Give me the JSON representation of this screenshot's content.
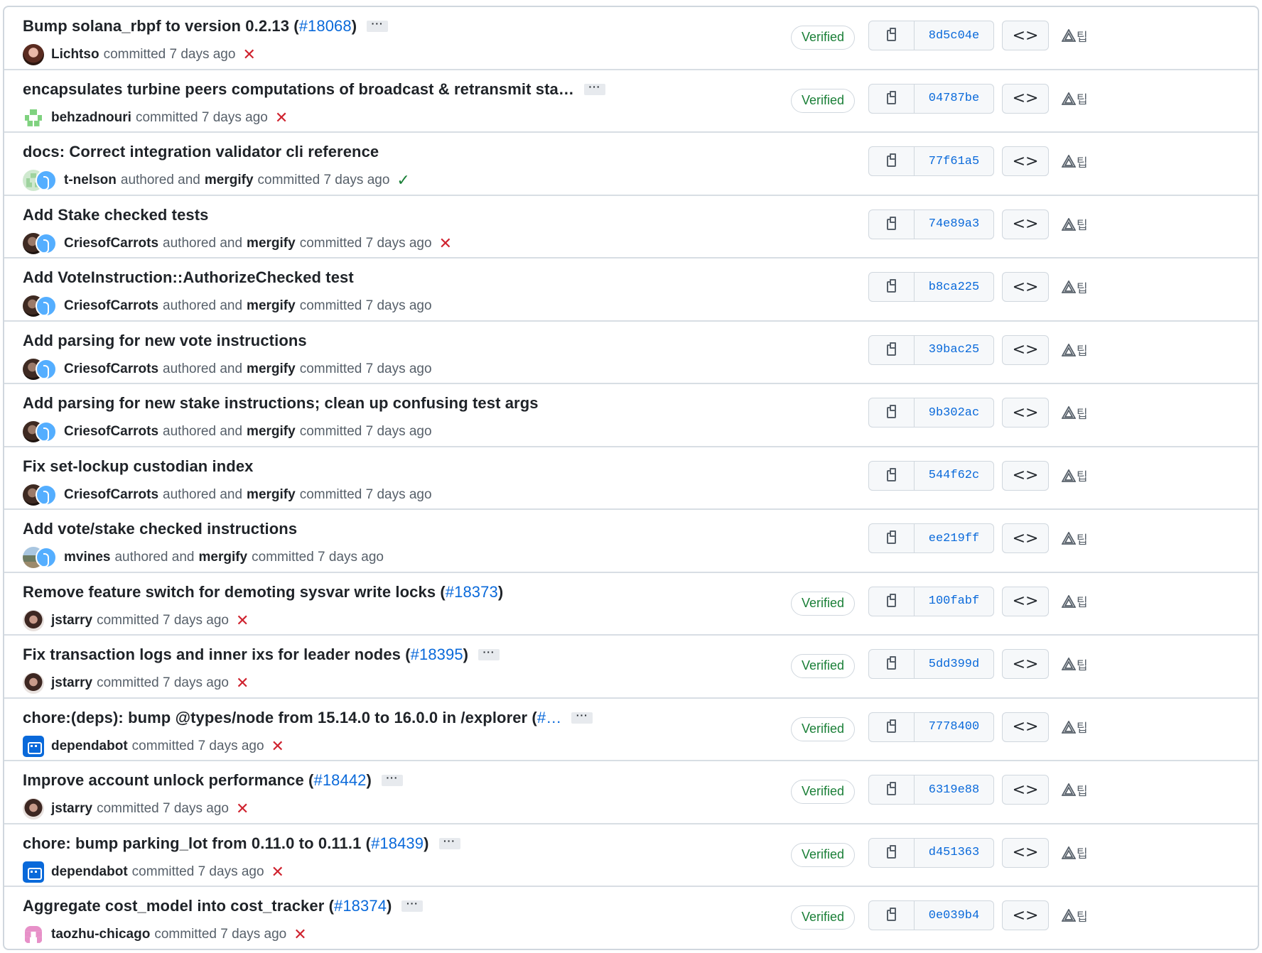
{
  "commits": [
    {
      "message": "Bump solana_rbpf to version 0.2.13 (",
      "pr": "#18068",
      "close": ")",
      "has_ellipsis": true,
      "avatars": [
        "av-dark"
      ],
      "author": "Lichtso",
      "author_text": "",
      "committer": "",
      "committed_text": "committed 7 days ago",
      "status": "fail",
      "verified": "Verified",
      "sha": "8d5c04e"
    },
    {
      "message": "encapsulates turbine peers computations of broadcast & retransmit sta…",
      "pr": "",
      "close": "",
      "has_ellipsis": true,
      "avatars": [
        "av-pix"
      ],
      "author": "behzadnouri",
      "author_text": "",
      "committer": "",
      "committed_text": "committed 7 days ago",
      "status": "fail",
      "verified": "Verified",
      "sha": "04787be"
    },
    {
      "message": "docs: Correct integration validator cli reference",
      "pr": "",
      "close": "",
      "has_ellipsis": false,
      "avatars": [
        "av-tn",
        "av-merge"
      ],
      "author": "t-nelson",
      "author_text": "authored and",
      "committer": "mergify",
      "committed_text": "committed 7 days ago",
      "status": "ok",
      "verified": "",
      "sha": "77f61a5"
    },
    {
      "message": "Add Stake checked tests",
      "pr": "",
      "close": "",
      "has_ellipsis": false,
      "avatars": [
        "av-cries",
        "av-merge"
      ],
      "author": "CriesofCarrots",
      "author_text": "authored and",
      "committer": "mergify",
      "committed_text": "committed 7 days ago",
      "status": "fail",
      "verified": "",
      "sha": "74e89a3"
    },
    {
      "message": "Add VoteInstruction::AuthorizeChecked test",
      "pr": "",
      "close": "",
      "has_ellipsis": false,
      "avatars": [
        "av-cries",
        "av-merge"
      ],
      "author": "CriesofCarrots",
      "author_text": "authored and",
      "committer": "mergify",
      "committed_text": "committed 7 days ago",
      "status": "",
      "verified": "",
      "sha": "b8ca225"
    },
    {
      "message": "Add parsing for new vote instructions",
      "pr": "",
      "close": "",
      "has_ellipsis": false,
      "avatars": [
        "av-cries",
        "av-merge"
      ],
      "author": "CriesofCarrots",
      "author_text": "authored and",
      "committer": "mergify",
      "committed_text": "committed 7 days ago",
      "status": "",
      "verified": "",
      "sha": "39bac25"
    },
    {
      "message": "Add parsing for new stake instructions; clean up confusing test args",
      "pr": "",
      "close": "",
      "has_ellipsis": false,
      "avatars": [
        "av-cries",
        "av-merge"
      ],
      "author": "CriesofCarrots",
      "author_text": "authored and",
      "committer": "mergify",
      "committed_text": "committed 7 days ago",
      "status": "",
      "verified": "",
      "sha": "9b302ac"
    },
    {
      "message": "Fix set-lockup custodian index",
      "pr": "",
      "close": "",
      "has_ellipsis": false,
      "avatars": [
        "av-cries",
        "av-merge"
      ],
      "author": "CriesofCarrots",
      "author_text": "authored and",
      "committer": "mergify",
      "committed_text": "committed 7 days ago",
      "status": "",
      "verified": "",
      "sha": "544f62c"
    },
    {
      "message": "Add vote/stake checked instructions",
      "pr": "",
      "close": "",
      "has_ellipsis": false,
      "avatars": [
        "av-mv",
        "av-merge"
      ],
      "author": "mvines",
      "author_text": "authored and",
      "committer": "mergify",
      "committed_text": "committed 7 days ago",
      "status": "",
      "verified": "",
      "sha": "ee219ff"
    },
    {
      "message": "Remove feature switch for demoting sysvar write locks (",
      "pr": "#18373",
      "close": ")",
      "has_ellipsis": false,
      "avatars": [
        "av-js"
      ],
      "author": "jstarry",
      "author_text": "",
      "committer": "",
      "committed_text": "committed 7 days ago",
      "status": "fail",
      "verified": "Verified",
      "sha": "100fabf"
    },
    {
      "message": "Fix transaction logs and inner ixs for leader nodes (",
      "pr": "#18395",
      "close": ")",
      "has_ellipsis": true,
      "avatars": [
        "av-js"
      ],
      "author": "jstarry",
      "author_text": "",
      "committer": "",
      "committed_text": "committed 7 days ago",
      "status": "fail",
      "verified": "Verified",
      "sha": "5dd399d"
    },
    {
      "message": "chore:(deps): bump @types/node from 15.14.0 to 16.0.0 in /explorer (",
      "pr": "#…",
      "close": "",
      "has_ellipsis": true,
      "avatars": [
        "av-bot"
      ],
      "author": "dependabot",
      "author_text": "",
      "committer": "",
      "committed_text": "committed 7 days ago",
      "status": "fail",
      "verified": "Verified",
      "sha": "7778400"
    },
    {
      "message": "Improve account unlock performance (",
      "pr": "#18442",
      "close": ")",
      "has_ellipsis": true,
      "avatars": [
        "av-js"
      ],
      "author": "jstarry",
      "author_text": "",
      "committer": "",
      "committed_text": "committed 7 days ago",
      "status": "fail",
      "verified": "Verified",
      "sha": "6319e88"
    },
    {
      "message": "chore: bump parking_lot from 0.11.0 to 0.11.1 (",
      "pr": "#18439",
      "close": ")",
      "has_ellipsis": true,
      "avatars": [
        "av-bot"
      ],
      "author": "dependabot",
      "author_text": "",
      "committer": "",
      "committed_text": "committed 7 days ago",
      "status": "fail",
      "verified": "Verified",
      "sha": "d451363"
    },
    {
      "message": "Aggregate cost_model into cost_tracker (",
      "pr": "#18374",
      "close": ")",
      "has_ellipsis": true,
      "avatars": [
        "av-tz"
      ],
      "author": "taozhu-chicago",
      "author_text": "",
      "committer": "",
      "committed_text": "committed 7 days ago",
      "status": "fail",
      "verified": "Verified",
      "sha": "0e039b4"
    }
  ],
  "labels": {
    "ellipsis": "···",
    "browse": "<>",
    "ext_suffix": "팁",
    "fail_icon": "✕",
    "ok_icon": "✓"
  },
  "colors": {
    "link": "#0969da",
    "verified": "#1a7f37",
    "fail": "#cf222e",
    "border": "#d0d7de"
  }
}
